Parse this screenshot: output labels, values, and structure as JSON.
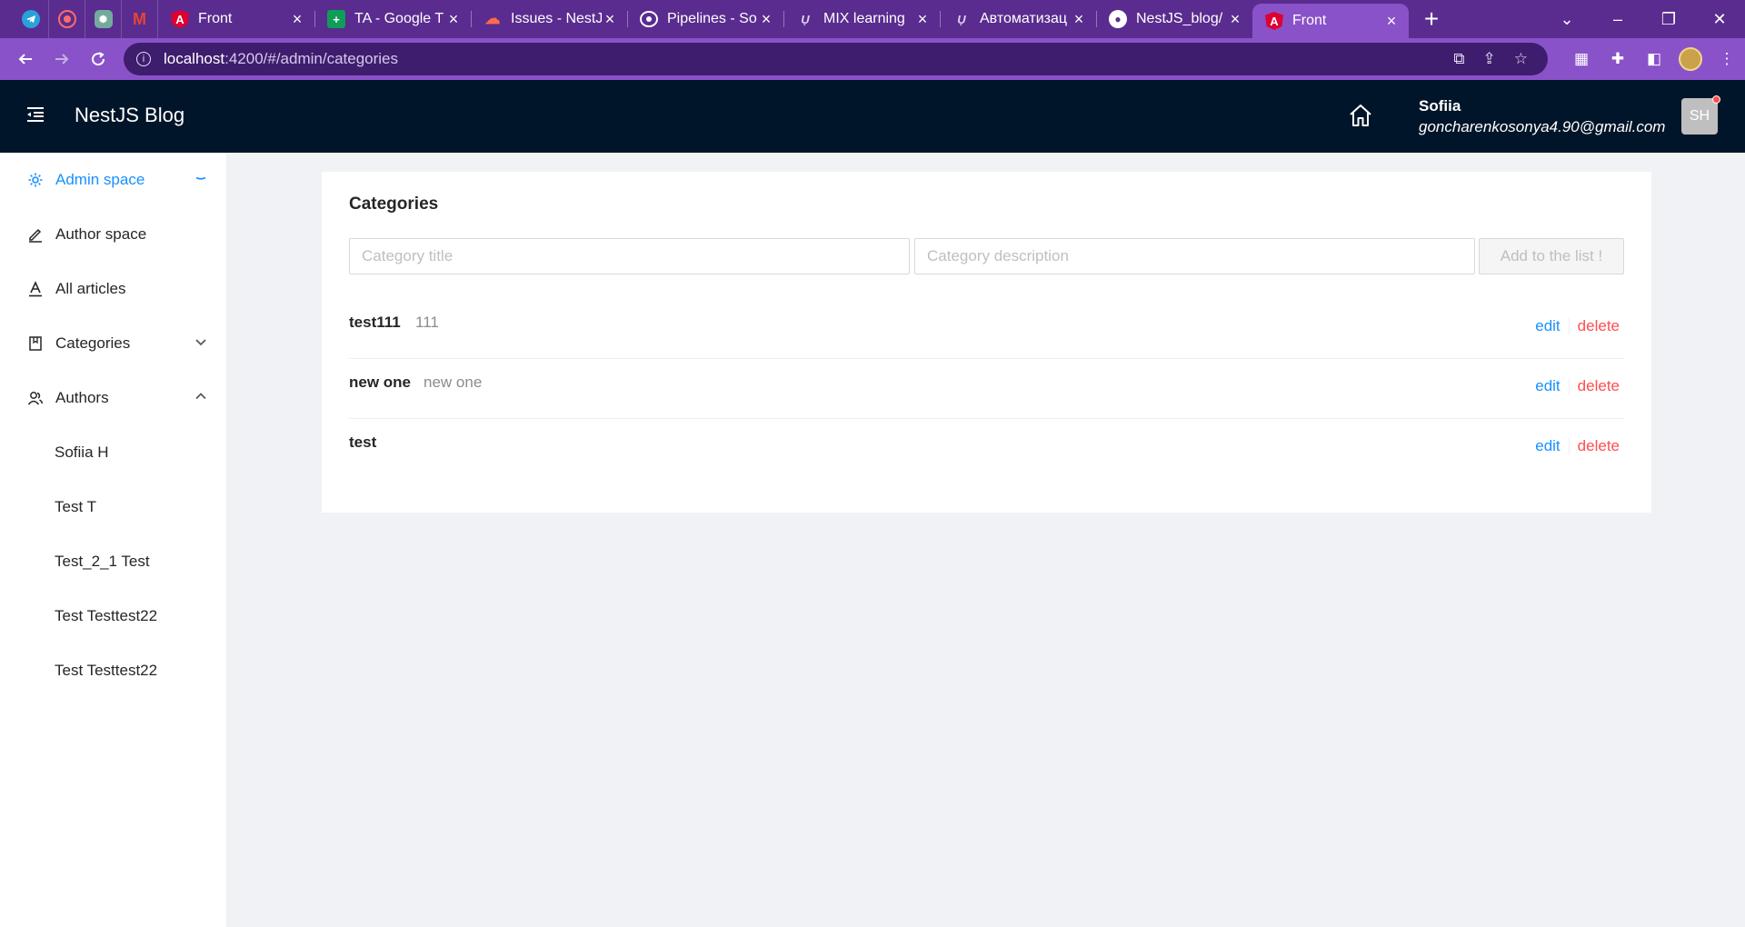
{
  "browser": {
    "pinned_icons": [
      "telegram-icon",
      "record-icon",
      "chatgpt-icon",
      "gmail-icon"
    ],
    "tabs": [
      {
        "title": "Front",
        "icon": "angular-icon"
      },
      {
        "title": "TA - Google T",
        "icon": "google-sheets-icon"
      },
      {
        "title": "Issues - NestJ",
        "icon": "cloud-icon"
      },
      {
        "title": "Pipelines - So",
        "icon": "pipelines-icon"
      },
      {
        "title": "MIX learning",
        "icon": "umix-icon"
      },
      {
        "title": "Автоматизац",
        "icon": "umix-icon"
      },
      {
        "title": "NestJS_blog/",
        "icon": "github-icon"
      },
      {
        "title": "Front",
        "icon": "angular-icon"
      }
    ],
    "url_host": "localhost",
    "url_path": ":4200/#/admin/categories"
  },
  "header": {
    "app_title": "NestJS Blog",
    "user_name": "Sofiia",
    "user_email": "goncharenkosonya4.90@gmail.com",
    "avatar_initials": "SH"
  },
  "sidebar": {
    "items": [
      {
        "label": "Admin space",
        "icon": "gear-icon"
      },
      {
        "label": "Author space",
        "icon": "pen-icon"
      },
      {
        "label": "All articles",
        "icon": "font-icon"
      },
      {
        "label": "Categories",
        "icon": "book-icon"
      },
      {
        "label": "Authors",
        "icon": "team-icon"
      }
    ],
    "authors": [
      "Sofiia H",
      "Test T",
      "Test_2_1 Test",
      "Test Testtest22",
      "Test Testtest22"
    ]
  },
  "main": {
    "title": "Categories",
    "title_placeholder": "Category title",
    "description_placeholder": "Category description",
    "add_button": "Add to the list !",
    "edit_label": "edit",
    "delete_label": "delete",
    "categories": [
      {
        "title": "test111",
        "description": "111"
      },
      {
        "title": "new one",
        "description": "new one"
      },
      {
        "title": "test",
        "description": ""
      }
    ]
  },
  "colors": {
    "accent": "#1890ff",
    "danger": "#ff4d4f",
    "header_bg": "#001529",
    "browser_frame": "#8a52c9"
  }
}
